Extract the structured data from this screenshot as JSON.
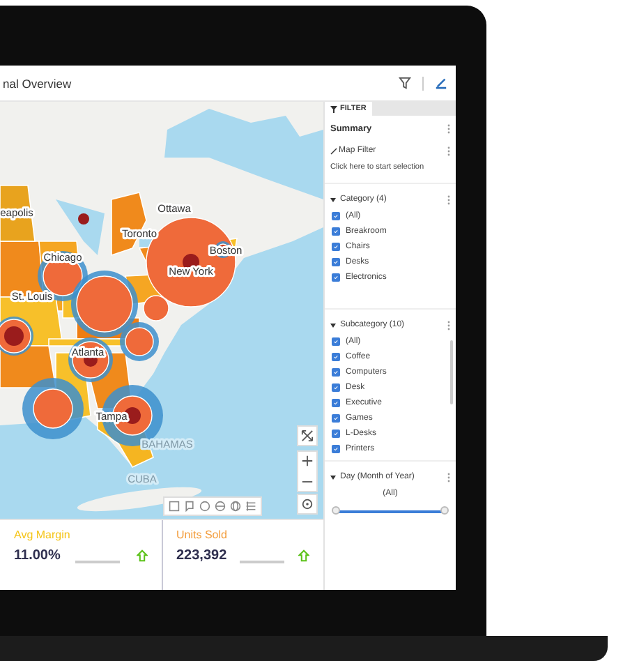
{
  "window": {
    "title": "nal Overview"
  },
  "map": {
    "labels": [
      {
        "text": "eapolis",
        "kind": "city"
      },
      {
        "text": "Ottawa",
        "kind": "city"
      },
      {
        "text": "Toronto",
        "kind": "city"
      },
      {
        "text": "Chicago",
        "kind": "city"
      },
      {
        "text": "Boston",
        "kind": "city"
      },
      {
        "text": "New York",
        "kind": "city"
      },
      {
        "text": "St. Louis",
        "kind": "city"
      },
      {
        "text": "Atlanta",
        "kind": "city"
      },
      {
        "text": "Tampa",
        "kind": "city"
      },
      {
        "text": "BAHAMAS",
        "kind": "country"
      },
      {
        "text": "CUBA",
        "kind": "country"
      }
    ]
  },
  "filter_panel": {
    "tab": {
      "label": "FILTER",
      "selected": true
    },
    "summary": {
      "title": "Summary"
    },
    "map_filter": {
      "label": "Map Filter",
      "hint": "Click here to start selection"
    },
    "sections": [
      {
        "title": "Category (4)",
        "kind": "checklist",
        "expanded": true,
        "items": [
          {
            "label": "(All)",
            "checked": true
          },
          {
            "label": "Breakroom",
            "checked": true
          },
          {
            "label": "Chairs",
            "checked": true
          },
          {
            "label": "Desks",
            "checked": true
          },
          {
            "label": "Electronics",
            "checked": true
          }
        ]
      },
      {
        "title": "Subcategory (10)",
        "kind": "checklist",
        "expanded": true,
        "items": [
          {
            "label": "(All)",
            "checked": true
          },
          {
            "label": "Coffee",
            "checked": true
          },
          {
            "label": "Computers",
            "checked": true
          },
          {
            "label": "Desk",
            "checked": true
          },
          {
            "label": "Executive",
            "checked": true
          },
          {
            "label": "Games",
            "checked": true
          },
          {
            "label": "L-Desks",
            "checked": true
          },
          {
            "label": "Printers",
            "checked": true
          }
        ]
      },
      {
        "title": "Day (Month of Year)",
        "kind": "range",
        "expanded": true,
        "value": "(All)",
        "level": 1
      }
    ]
  },
  "kpis": [
    {
      "label": "Avg Margin",
      "value": "11.00%",
      "color": "#f5c518",
      "kind": "up"
    },
    {
      "label": "Units Sold",
      "value": "223,392",
      "color": "#f39c3a",
      "kind": "up"
    }
  ]
}
